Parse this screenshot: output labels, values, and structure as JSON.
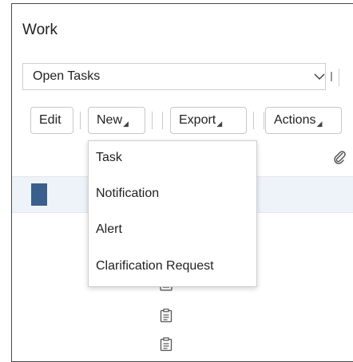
{
  "panel": {
    "title": "Work"
  },
  "filter": {
    "selected": "Open Tasks"
  },
  "toolbar": {
    "edit_label": "Edit",
    "new_label": "New",
    "export_label": "Export",
    "actions_label": "Actions"
  },
  "new_menu": {
    "items": [
      "Task",
      "Notification",
      "Alert",
      "Clarification Request"
    ]
  },
  "colors": {
    "selected_row": "#eef3fa",
    "row_marker": "#3a5f8c"
  },
  "icons": [
    "chevron-down-icon",
    "paperclip-icon",
    "document-icon"
  ]
}
